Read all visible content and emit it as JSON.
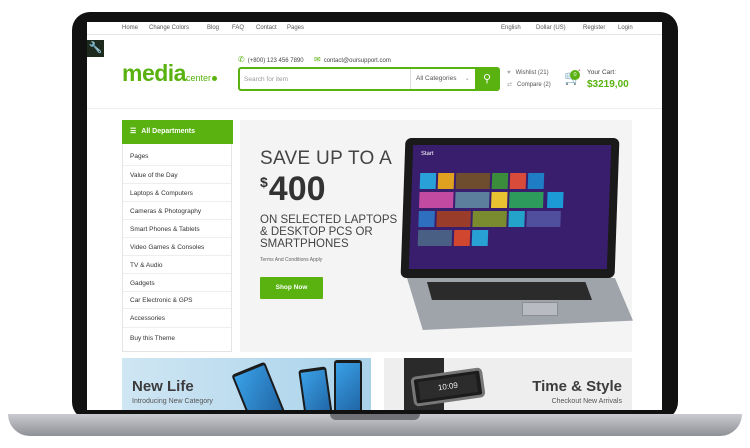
{
  "topnav": {
    "left": [
      "Home",
      "Change Colors",
      "Blog",
      "FAQ",
      "Contact",
      "Pages"
    ],
    "right": [
      "English",
      "Dollar (US)",
      "Register",
      "Login"
    ]
  },
  "logo": {
    "main": "media",
    "sub": "center"
  },
  "contact": {
    "phone": "(+800) 123 456 7890",
    "email": "contact@oursupport.com"
  },
  "search": {
    "placeholder": "Search for item",
    "category": "All Categories"
  },
  "wishlist": {
    "label": "Wishlist (21)"
  },
  "compare": {
    "label": "Compare (2)"
  },
  "cart": {
    "label": "Your Cart:",
    "total": "$3219,00",
    "count": "0"
  },
  "sidebar": {
    "title": "All Departments",
    "items": [
      "Pages",
      "Value of the Day",
      "Laptops & Computers",
      "Cameras & Photography",
      "Smart Phones & Tablets",
      "Video Games & Consoles",
      "TV & Audio",
      "Gadgets",
      "Car Electronic & GPS",
      "Accessories",
      "Buy this Theme"
    ]
  },
  "hero": {
    "headline": "SAVE UP TO A",
    "currency": "$",
    "amount": "400",
    "sub": [
      "ON SELECTED LAPTOPS",
      "& DESKTOP PCS OR",
      "SMARTPHONES"
    ],
    "terms": "Terms And Conditions Apply",
    "button": "Shop Now",
    "screen_start": "Start"
  },
  "promos": [
    {
      "title": "New Life",
      "sub": "Introducing New Category"
    },
    {
      "title": "Time & Style",
      "sub": "Checkout New Arrivals"
    }
  ],
  "watch_time": "10:09",
  "colors": {
    "accent": "#59b210"
  }
}
